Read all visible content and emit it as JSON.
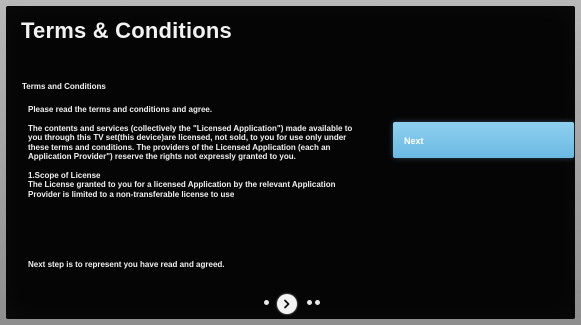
{
  "screen": {
    "title": "Terms & Conditions"
  },
  "terms": {
    "heading": "Terms and Conditions",
    "paragraphs": [
      "Please read the terms and conditions and agree.",
      "The contents and services (collectively the \"Licensed Application\") made available to you through this TV set(this device)are licensed, not sold, to you for use only under these terms and conditions. The providers of the Licensed Application (each an Application Provider\") reserve the rights not expressly granted to you.",
      "1.Scope of License",
      "The License granted to you for a licensed Application by the relevant Application Provider is limited to a non-transferable license to use"
    ],
    "footer": "Next step is to represent you have read and agreed."
  },
  "actions": {
    "next_label": "Next"
  },
  "pager": {
    "current_page": 2,
    "total_pages": 4
  }
}
